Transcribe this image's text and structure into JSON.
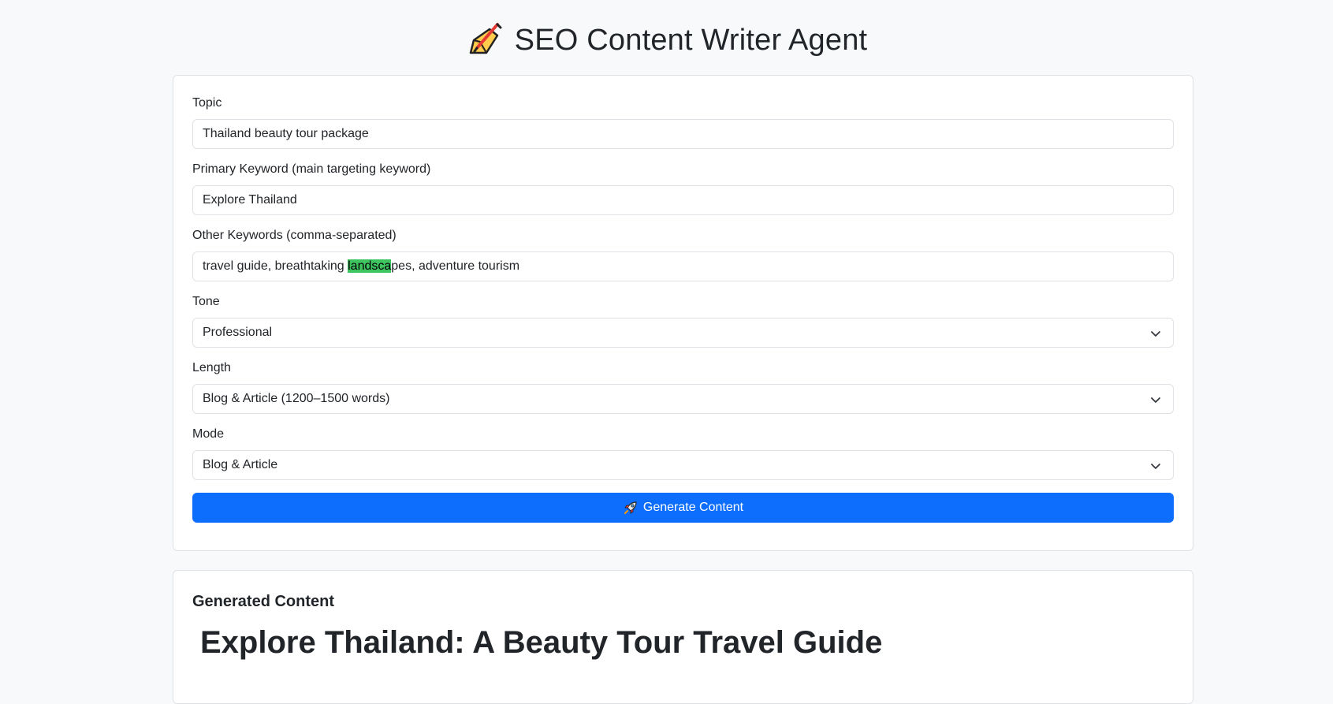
{
  "header": {
    "icon": "writing-hand-icon",
    "title": "SEO Content Writer Agent"
  },
  "form": {
    "topic": {
      "label": "Topic",
      "value": "Thailand beauty tour package"
    },
    "primary_keyword": {
      "label": "Primary Keyword (main targeting keyword)",
      "value": "Explore Thailand"
    },
    "other_keywords": {
      "label": "Other Keywords (comma-separated)",
      "value_before": "travel guide, breathtaking ",
      "value_selected": "landsca",
      "value_after": "pes, adventure tourism"
    },
    "tone": {
      "label": "Tone",
      "selected": "Professional"
    },
    "length": {
      "label": "Length",
      "selected": "Blog & Article (1200–1500 words)"
    },
    "mode": {
      "label": "Mode",
      "selected": "Blog & Article"
    },
    "generate_button": {
      "icon": "rocket-icon",
      "label": "Generate Content"
    }
  },
  "output": {
    "section_title": "Generated Content",
    "article_title": "Explore Thailand: A Beauty Tour Travel Guide"
  },
  "colors": {
    "background": "#f8f9fa",
    "primary": "#0d6efd",
    "selection": "#3fc55f",
    "border": "#dee2e6"
  }
}
